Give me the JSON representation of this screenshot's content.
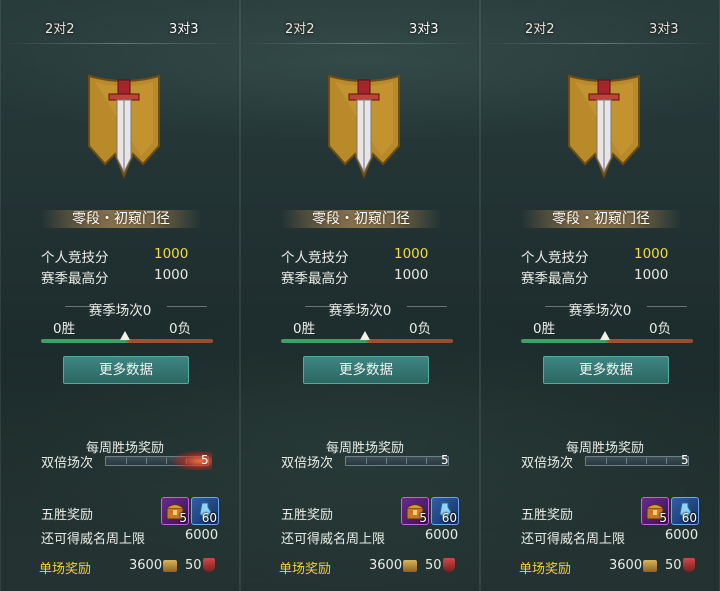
{
  "panels": [
    {
      "tabs": [
        "2对2",
        "3对3"
      ],
      "active_tab": 1,
      "rank_title": "零段・初窥门径",
      "personal_score_label": "个人竞技分",
      "personal_score": "1000",
      "season_high_label": "赛季最高分",
      "season_high": "1000",
      "season_matches": "赛季场次0",
      "wins": "0胜",
      "losses": "0负",
      "more_data_button": "更多数据",
      "weekly_reward_title": "每周胜场奖励",
      "double_label": "双倍场次",
      "double_count": "5",
      "five_win_label": "五胜奖励",
      "chest_count": "5",
      "potion_count": "60",
      "fame_cap_label": "还可得威名周上限",
      "fame_cap": "6000",
      "single_reward_label": "单场奖励",
      "single_coin": "3600",
      "single_honor": "50"
    },
    {
      "tabs": [
        "2对2",
        "3对3"
      ],
      "active_tab": 1,
      "rank_title": "零段・初窥门径",
      "personal_score_label": "个人竞技分",
      "personal_score": "1000",
      "season_high_label": "赛季最高分",
      "season_high": "1000",
      "season_matches": "赛季场次0",
      "wins": "0胜",
      "losses": "0负",
      "more_data_button": "更多数据",
      "weekly_reward_title": "每周胜场奖励",
      "double_label": "双倍场次",
      "double_count": "5",
      "five_win_label": "五胜奖励",
      "chest_count": "5",
      "potion_count": "60",
      "fame_cap_label": "还可得威名周上限",
      "fame_cap": "6000",
      "single_reward_label": "单场奖励",
      "single_coin": "3600",
      "single_honor": "50"
    },
    {
      "tabs": [
        "2对2",
        "3对3"
      ],
      "active_tab": 1,
      "rank_title": "零段・初窥门径",
      "personal_score_label": "个人竞技分",
      "personal_score": "1000",
      "season_high_label": "赛季最高分",
      "season_high": "1000",
      "season_matches": "赛季场次0",
      "wins": "0胜",
      "losses": "0负",
      "more_data_button": "更多数据",
      "weekly_reward_title": "每周胜场奖励",
      "double_label": "双倍场次",
      "double_count": "5",
      "five_win_label": "五胜奖励",
      "chest_count": "5",
      "potion_count": "60",
      "fame_cap_label": "还可得威名周上限",
      "fame_cap": "6000",
      "single_reward_label": "单场奖励",
      "single_coin": "3600",
      "single_honor": "50"
    }
  ],
  "colors": {
    "gold_text": "#f3dd3a",
    "win_bar": "#3aa264",
    "loss_bar": "#a0503a",
    "button": "#3e8682"
  },
  "icons": [
    "sword-banner-emblem-icon",
    "treasure-chest-icon",
    "potion-icon",
    "coin-icon",
    "honor-shield-icon"
  ]
}
